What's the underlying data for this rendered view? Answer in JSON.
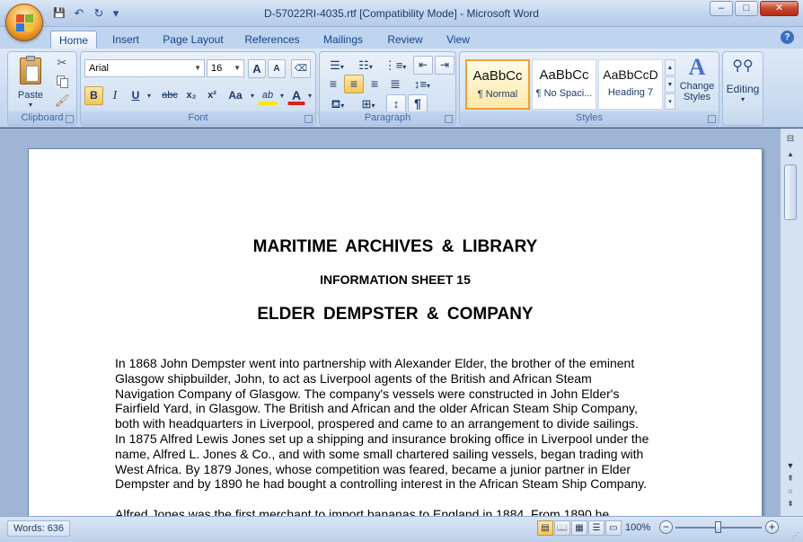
{
  "window": {
    "title": "D-57022RI-4035.rtf [Compatibility Mode] - Microsoft Word",
    "minimize": "–",
    "maximize": "□",
    "close": "✕"
  },
  "qat": {
    "save": "💾",
    "undo": "↶",
    "redo": "↻",
    "customize": "▾"
  },
  "tabs": [
    {
      "label": "Home",
      "active": true
    },
    {
      "label": "Insert"
    },
    {
      "label": "Page Layout"
    },
    {
      "label": "References"
    },
    {
      "label": "Mailings"
    },
    {
      "label": "Review"
    },
    {
      "label": "View"
    }
  ],
  "help": "?",
  "ribbon": {
    "clipboard": {
      "label": "Clipboard",
      "paste": "Paste"
    },
    "font": {
      "label": "Font",
      "family": "Arial",
      "size": "16",
      "grow": "A",
      "shrink": "A",
      "bold": "B",
      "italic": "I",
      "underline": "U",
      "strike": "abc",
      "subscript": "x₂",
      "superscript": "x²",
      "case": "Aa",
      "highlight": "ab",
      "font_color": "A"
    },
    "paragraph": {
      "label": "Paragraph",
      "sort": "↕",
      "show_marks": "¶"
    },
    "styles": {
      "label": "Styles",
      "items": [
        {
          "sample": "AaBbCc",
          "name": "¶ Normal",
          "selected": true
        },
        {
          "sample": "AaBbCc",
          "name": "¶ No Spaci..."
        },
        {
          "sample": "AaBbCcD",
          "name": "Heading 7"
        }
      ],
      "change_styles": "Change Styles",
      "change_styles_line1": "Change",
      "change_styles_line2": "Styles"
    },
    "editing": {
      "label": "Editing"
    }
  },
  "document": {
    "heading1": "MARITIME ARCHIVES & LIBRARY",
    "heading2": "INFORMATION SHEET 15",
    "heading3": "ELDER DEMPSTER & COMPANY",
    "paragraph1_lines": [
      "In 1868 John Dempster went into partnership with Alexander Elder, the brother of the eminent",
      "Glasgow shipbuilder, John, to act as Liverpool agents of the British and African Steam",
      "Navigation Company of Glasgow.   The company's vessels were constructed in John Elder's",
      "Fairfield Yard, in Glasgow.   The British and African and the older African Steam Ship Company,",
      "both with headquarters in Liverpool, prospered and came to an arrangement to divide sailings.",
      "In 1875 Alfred Lewis Jones set up a shipping and insurance broking office in Liverpool under the",
      "name, Alfred L. Jones & Co., and with some small chartered sailing vessels, began trading with",
      "West Africa.  By 1879 Jones, whose competition was feared, became a junior partner in Elder",
      "Dempster and by 1890 he had bought a controlling interest in the African Steam Ship Company."
    ],
    "paragraph2_lines": [
      "Alfred Jones was the first merchant to import bananas to England in 1884.   From 1890 he"
    ]
  },
  "status": {
    "words": "Words: 636",
    "zoom": "100%",
    "zoom_level": 1.0
  },
  "colors": {
    "accent": "#15428b",
    "ribbon": "#c9daf0",
    "selected_style": "#e7a23a"
  }
}
